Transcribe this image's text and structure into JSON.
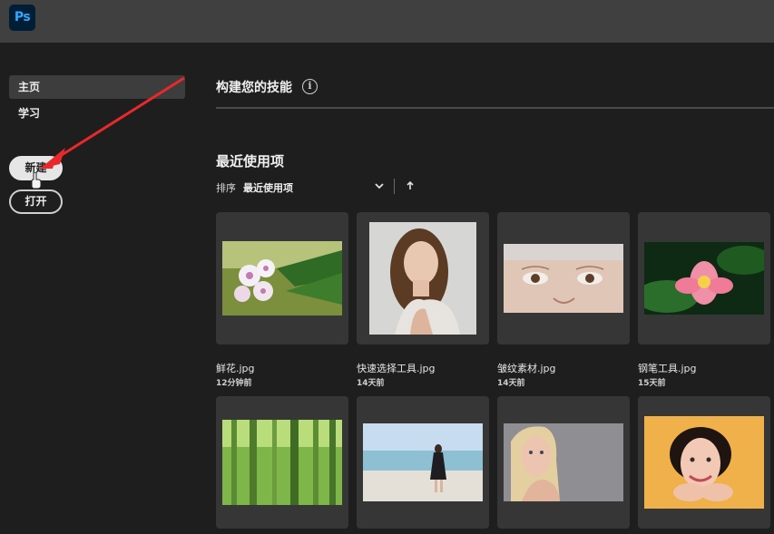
{
  "app": {
    "logo_text": "Ps"
  },
  "sidebar": {
    "items": [
      {
        "label": "主页",
        "active": true
      },
      {
        "label": "学习",
        "active": false
      }
    ],
    "new_button": "新建",
    "open_button": "打开"
  },
  "main": {
    "skills_title": "构建您的技能",
    "recent_title": "最近使用项",
    "sort_label": "排序",
    "sort_value": "最近使用项"
  },
  "files": [
    {
      "name": "鲜花.jpg",
      "time": "12分钟前"
    },
    {
      "name": "快速选择工具.jpg",
      "time": "14天前"
    },
    {
      "name": "皱纹素材.jpg",
      "time": "14天前"
    },
    {
      "name": "钢笔工具.jpg",
      "time": "15天前"
    }
  ],
  "colors": {
    "accent": "#31a8ff",
    "annotation": "#e8292b",
    "card": "#363636",
    "topbar": "#404040"
  },
  "icons": [
    "ps-logo",
    "info-icon",
    "chevron-down-icon",
    "arrow-up-icon",
    "cursor-icon",
    "annotation-arrow"
  ]
}
